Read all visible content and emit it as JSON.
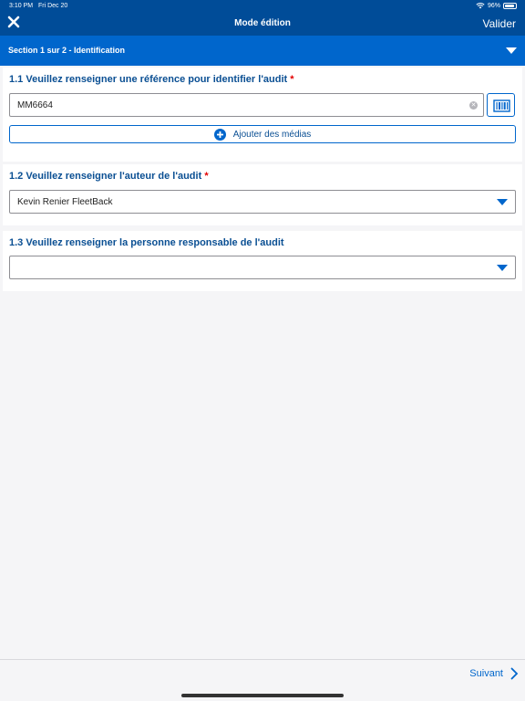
{
  "status_bar": {
    "time": "3:10 PM",
    "date": "Fri Dec 20",
    "battery": "96%"
  },
  "nav": {
    "title": "Mode édition",
    "validate_label": "Valider",
    "close_icon": "close-icon"
  },
  "section": {
    "title": "Section 1 sur 2 - Identification",
    "caret_icon": "chevron-down-icon"
  },
  "questions": [
    {
      "label": "1.1 Veuillez renseigner une référence pour identifier l'audit",
      "required_mark": "*",
      "value": "MM6664",
      "media_label": "Ajouter des médias"
    },
    {
      "label": "1.2 Veuillez renseigner l'auteur de l'audit",
      "required_mark": "*",
      "selected": "Kevin Renier FleetBack"
    },
    {
      "label": "1.3 Veuillez renseigner la personne responsable de l'audit",
      "selected": ""
    }
  ],
  "footer": {
    "next_label": "Suivant"
  },
  "colors": {
    "nav_bg": "#004c98",
    "section_bg": "#0066cc",
    "question_text": "#0a4f93",
    "required": "#e30000",
    "accent": "#0066cc"
  }
}
